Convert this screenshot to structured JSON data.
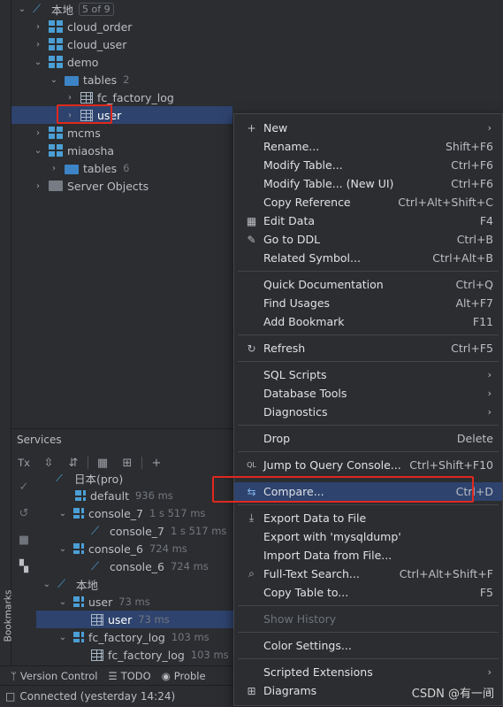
{
  "tree": {
    "root": {
      "label": "本地",
      "badge": "5 of 9"
    },
    "items": [
      {
        "label": "cloud_order"
      },
      {
        "label": "cloud_user"
      },
      {
        "label": "demo"
      },
      {
        "label": "tables",
        "count": "2"
      },
      {
        "label": "fc_factory_log"
      },
      {
        "label": "user"
      },
      {
        "label": "mcms"
      },
      {
        "label": "miaosha"
      },
      {
        "label": "tables",
        "count": "6"
      },
      {
        "label": "Server Objects"
      }
    ]
  },
  "services": {
    "title": "Services",
    "toolbar": {
      "tx": "Tx"
    },
    "rows": [
      {
        "label": "日本(pro)",
        "meta": ""
      },
      {
        "label": "default",
        "meta": "936 ms"
      },
      {
        "label": "console_7",
        "meta": "1 s 517 ms"
      },
      {
        "label": "console_7",
        "meta": "1 s 517 ms"
      },
      {
        "label": "console_6",
        "meta": "724 ms"
      },
      {
        "label": "console_6",
        "meta": "724 ms"
      },
      {
        "label": "本地",
        "meta": ""
      },
      {
        "label": "user",
        "meta": "73 ms"
      },
      {
        "label": "user",
        "meta": "73 ms"
      },
      {
        "label": "fc_factory_log",
        "meta": "103 ms"
      },
      {
        "label": "fc_factory_log",
        "meta": "103 ms"
      }
    ]
  },
  "bottom_tabs": {
    "version_control": "Version Control",
    "todo": "TODO",
    "problems": "Proble"
  },
  "sidebar_label": "Bookmarks",
  "status": {
    "text": "Connected (yesterday 14:24)"
  },
  "watermark": "CSDN @有一间",
  "menu": [
    {
      "label": "New",
      "key": "",
      "icon": "+",
      "arrow": true
    },
    {
      "label": "Rename...",
      "key": "Shift+F6",
      "icon": ""
    },
    {
      "label": "Modify Table...",
      "key": "Ctrl+F6",
      "icon": ""
    },
    {
      "label": "Modify Table... (New UI)",
      "key": "Ctrl+F6",
      "icon": ""
    },
    {
      "label": "Copy Reference",
      "key": "Ctrl+Alt+Shift+C",
      "icon": ""
    },
    {
      "label": "Edit Data",
      "key": "F4",
      "icon": "▦"
    },
    {
      "label": "Go to DDL",
      "key": "Ctrl+B",
      "icon": "✎"
    },
    {
      "label": "Related Symbol...",
      "key": "Ctrl+Alt+B",
      "icon": ""
    },
    {
      "label": "Quick Documentation",
      "key": "Ctrl+Q",
      "icon": ""
    },
    {
      "label": "Find Usages",
      "key": "Alt+F7",
      "icon": ""
    },
    {
      "label": "Add Bookmark",
      "key": "F11",
      "icon": ""
    },
    {
      "label": "Refresh",
      "key": "Ctrl+F5",
      "icon": "↻"
    },
    {
      "label": "SQL Scripts",
      "key": "",
      "icon": "",
      "arrow": true
    },
    {
      "label": "Database Tools",
      "key": "",
      "icon": "",
      "arrow": true
    },
    {
      "label": "Diagnostics",
      "key": "",
      "icon": "",
      "arrow": true
    },
    {
      "label": "Drop",
      "key": "Delete",
      "icon": ""
    },
    {
      "label": "Jump to Query Console...",
      "key": "Ctrl+Shift+F10",
      "icon": "QL"
    },
    {
      "label": "Compare...",
      "key": "Ctrl+D",
      "icon": "⇆"
    },
    {
      "label": "Export Data to File",
      "key": "",
      "icon": "⤓"
    },
    {
      "label": "Export with 'mysqldump'",
      "key": "",
      "icon": ""
    },
    {
      "label": "Import Data from File...",
      "key": "",
      "icon": ""
    },
    {
      "label": "Full-Text Search...",
      "key": "Ctrl+Alt+Shift+F",
      "icon": "⌕"
    },
    {
      "label": "Copy Table to...",
      "key": "F5",
      "icon": ""
    },
    {
      "label": "Show History",
      "key": "",
      "icon": ""
    },
    {
      "label": "Color Settings...",
      "key": "",
      "icon": ""
    },
    {
      "label": "Scripted Extensions",
      "key": "",
      "icon": "",
      "arrow": true
    },
    {
      "label": "Diagrams",
      "key": "",
      "icon": "⊞",
      "arrow": true
    }
  ]
}
